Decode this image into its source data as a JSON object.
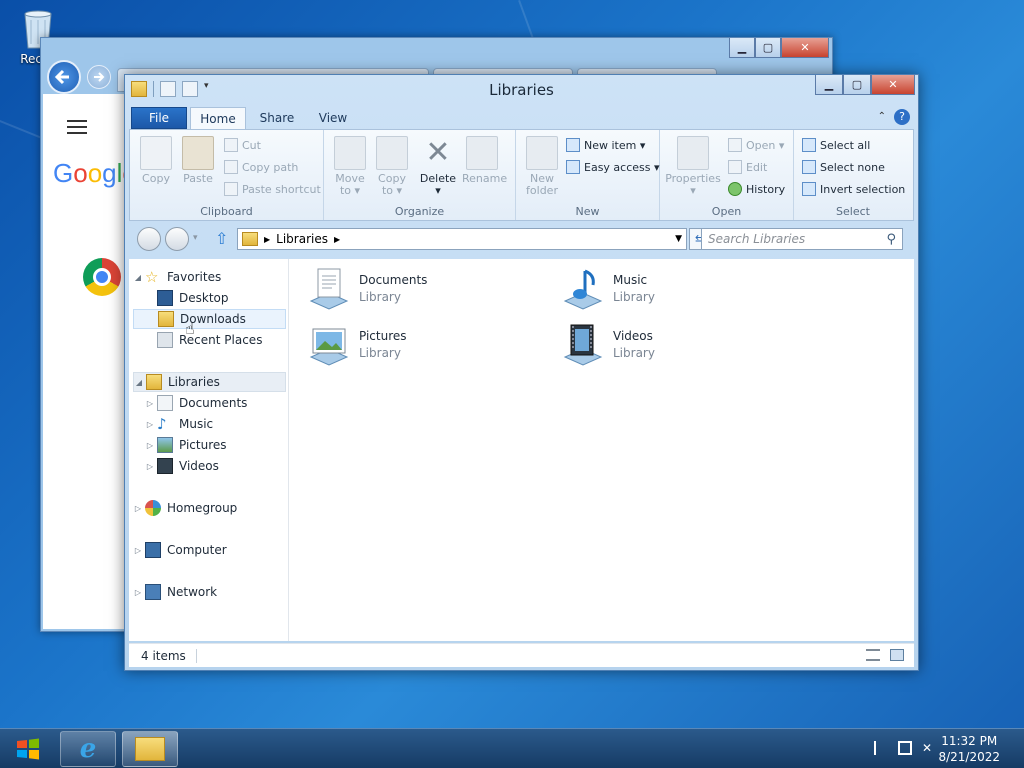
{
  "desktop": {
    "recycle_bin_label": "Recyc"
  },
  "explorer": {
    "title": "Libraries",
    "tabs": {
      "file": "File",
      "home": "Home",
      "share": "Share",
      "view": "View"
    },
    "ribbon": {
      "clipboard": {
        "label": "Clipboard",
        "copy": "Copy",
        "paste": "Paste",
        "cut": "Cut",
        "copy_path": "Copy path",
        "paste_shortcut": "Paste shortcut"
      },
      "organize": {
        "label": "Organize",
        "move_to": "Move to ▾",
        "copy_to": "Copy to ▾",
        "delete": "Delete ▾",
        "rename": "Rename"
      },
      "new": {
        "label": "New",
        "new_folder": "New folder",
        "new_item": "New item ▾",
        "easy_access": "Easy access ▾"
      },
      "open": {
        "label": "Open",
        "properties": "Properties ▾",
        "open": "Open ▾",
        "edit": "Edit",
        "history": "History"
      },
      "select": {
        "label": "Select",
        "select_all": "Select all",
        "select_none": "Select none",
        "invert_selection": "Invert selection"
      }
    },
    "address": {
      "path": "Libraries",
      "search_placeholder": "Search Libraries"
    },
    "nav": {
      "favorites": "Favorites",
      "desktop": "Desktop",
      "downloads": "Downloads",
      "recent_places": "Recent Places",
      "libraries": "Libraries",
      "documents": "Documents",
      "music": "Music",
      "pictures": "Pictures",
      "videos": "Videos",
      "homegroup": "Homegroup",
      "computer": "Computer",
      "network": "Network"
    },
    "items": [
      {
        "name": "Documents",
        "type": "Library"
      },
      {
        "name": "Music",
        "type": "Library"
      },
      {
        "name": "Pictures",
        "type": "Library"
      },
      {
        "name": "Videos",
        "type": "Library"
      }
    ],
    "status": "4 items"
  },
  "taskbar": {
    "time": "11:32 PM",
    "date": "8/21/2022"
  },
  "colors": {
    "accent": "#1c58a8",
    "desktop": "#1b74c9"
  }
}
